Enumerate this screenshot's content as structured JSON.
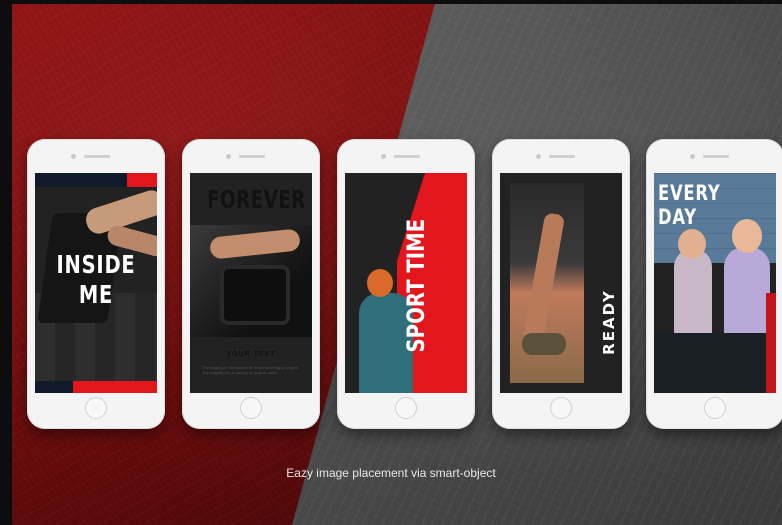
{
  "slides": [
    {
      "title_line1": "INSIDE",
      "title_line2": "ME"
    },
    {
      "title": "FOREVER",
      "subtitle": "YOUR TEXT",
      "body": "The tragedy in life doesn't lie in not reaching your goal. The tragedy lies in having no goal to reach."
    },
    {
      "title": "SPORT TIME"
    },
    {
      "title": "READY"
    },
    {
      "title_line1": "EVERY",
      "title_line2": "DAY"
    }
  ],
  "caption": "Eazy image placement via smart-object",
  "colors": {
    "accent": "#e3151d",
    "red_background": "#7a0e0e",
    "gray_background": "#555555"
  }
}
